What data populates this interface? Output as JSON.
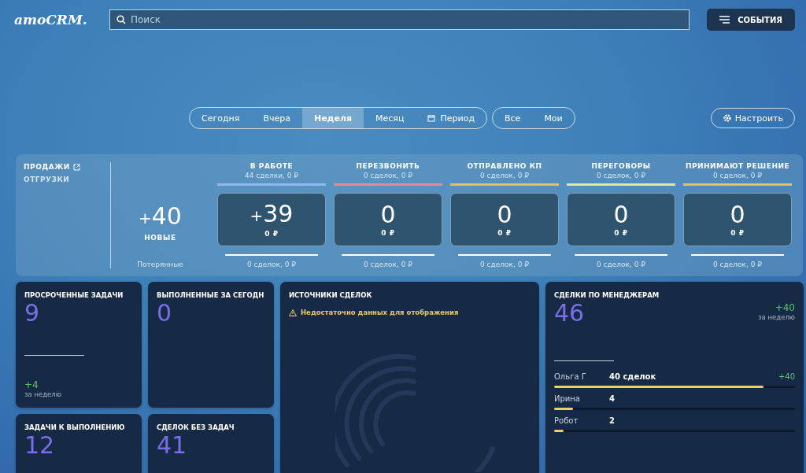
{
  "header": {
    "logo": "amoCRM.",
    "search": {
      "placeholder": "Поиск"
    },
    "events_button": "СОБЫТИЯ"
  },
  "period_tabs": [
    {
      "label": "Сегодня",
      "selected": false
    },
    {
      "label": "Вчера",
      "selected": false
    },
    {
      "label": "Неделя",
      "selected": true
    },
    {
      "label": "Месяц",
      "selected": false
    },
    {
      "label": "Период",
      "selected": false,
      "kind": "calendar"
    }
  ],
  "owner_tabs": [
    {
      "label": "Все",
      "selected": false
    },
    {
      "label": "Мои",
      "selected": false
    }
  ],
  "settings_button": "Настроить",
  "pipeline": {
    "tabs": [
      {
        "label": "ПРОДАЖИ",
        "selected": true
      },
      {
        "label": "ОТГРУЗКИ",
        "selected": false
      }
    ],
    "new": {
      "plus": "+",
      "value": "40",
      "label": "НОВЫЕ"
    },
    "lost_label": "Потерянные",
    "stages": [
      {
        "name": "В РАБОТЕ",
        "summary": "44 сделки, 0 ₽",
        "color": "#8fb8f0",
        "value": "39",
        "plus": "+",
        "amount": "0 ₽",
        "lost": "0 сделок, 0 ₽"
      },
      {
        "name": "ПЕРЕЗВОНИТЬ",
        "summary": "0 сделок, 0 ₽",
        "color": "#e88a8a",
        "value": "0",
        "amount": "0 ₽",
        "lost": "0 сделок, 0 ₽"
      },
      {
        "name": "ОТПРАВЛЕНО КП",
        "summary": "0 сделок, 0 ₽",
        "color": "#e8c064",
        "value": "0",
        "amount": "0 ₽",
        "lost": "0 сделок, 0 ₽"
      },
      {
        "name": "ПЕРЕГОВОРЫ",
        "summary": "0 сделок, 0 ₽",
        "color": "#d8ec9a",
        "value": "0",
        "amount": "0 ₽",
        "lost": "0 сделок, 0 ₽"
      },
      {
        "name": "ПРИНИМАЮТ РЕШЕНИЕ",
        "summary": "0 сделок, 0 ₽",
        "color": "#e8c064",
        "value": "0",
        "amount": "0 ₽",
        "lost": "0 сделок, 0 ₽"
      }
    ]
  },
  "widgets": {
    "overdue": {
      "title": "ПРОСРОЧЕННЫЕ ЗАДАЧИ",
      "value": "9",
      "delta": "+4",
      "period": "за неделю"
    },
    "done_today": {
      "title": "ВЫПОЛНЕННЫЕ ЗА СЕГОДН",
      "value": "0"
    },
    "sources": {
      "title": "ИСТОЧНИКИ СДЕЛОК",
      "warning": "Недостаточно данных для отображения"
    },
    "managers": {
      "title": "СДЕЛКИ ПО МЕНЕДЖЕРАМ",
      "value": "46",
      "delta": "+40",
      "period": "за неделю",
      "rows": [
        {
          "name": "Ольга Г",
          "count": "40 сделок",
          "delta": "+40",
          "level": 0.87
        },
        {
          "name": "Ирина",
          "count": "4",
          "level": 0.08
        },
        {
          "name": "Робот",
          "count": "2",
          "level": 0.04
        }
      ]
    },
    "todo": {
      "title": "ЗАДАЧИ К ВЫПОЛНЕНИЮ",
      "value": "12"
    },
    "no_tasks": {
      "title": "СДЕЛОК БЕЗ ЗАДАЧ",
      "value": "41"
    }
  }
}
